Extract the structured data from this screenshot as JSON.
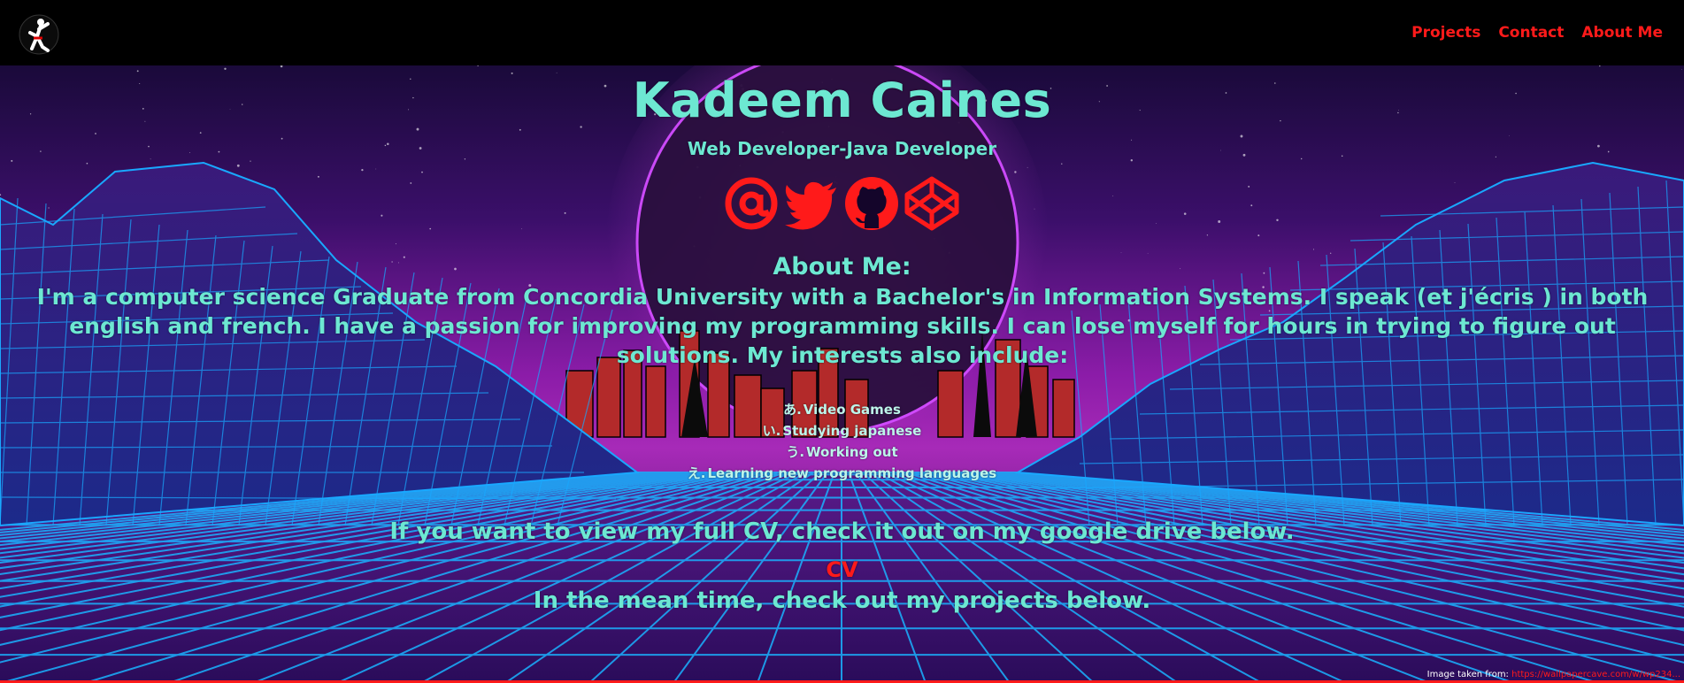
{
  "header": {
    "logo_icon": "karate-figure-icon",
    "nav": [
      {
        "label": "Projects"
      },
      {
        "label": "Contact"
      },
      {
        "label": "About Me"
      }
    ]
  },
  "hero": {
    "name": "Kadeem Caines",
    "subtitle": "Web Developer-Java Developer",
    "social_icons": [
      "email-at-icon",
      "twitter-bird-icon",
      "github-icon",
      "codepen-icon"
    ]
  },
  "about": {
    "title": "About Me:",
    "text": "I'm a computer science Graduate from Concordia University with a Bachelor's in Information Systems. I speak (et j'écris ) in both english and french. I have a passion for improving my programming skills. I can lose myself for hours in trying to figure out solutions. My interests also include:",
    "interests": [
      {
        "mark": "あ.",
        "label": "Video Games"
      },
      {
        "mark": "い.",
        "label": "Studying japanese"
      },
      {
        "mark": "う.",
        "label": "Working out"
      },
      {
        "mark": "え.",
        "label": "Learning new programming languages"
      }
    ]
  },
  "cv": {
    "text": "If you want to view my full CV, check it out on my google drive below.",
    "link_label": "CV",
    "follow_text": "In the mean time, check out my projects below."
  },
  "credit": {
    "label": "Image taken from:",
    "link": "https://wallpapercave.com/w/wp234..."
  },
  "colors": {
    "accent_text": "#6de8d2",
    "link_red": "#ff1a1a",
    "header_bg": "#000000",
    "grid_cyan": "#1ab2ff",
    "sky_purple": "#7a1aa0"
  }
}
